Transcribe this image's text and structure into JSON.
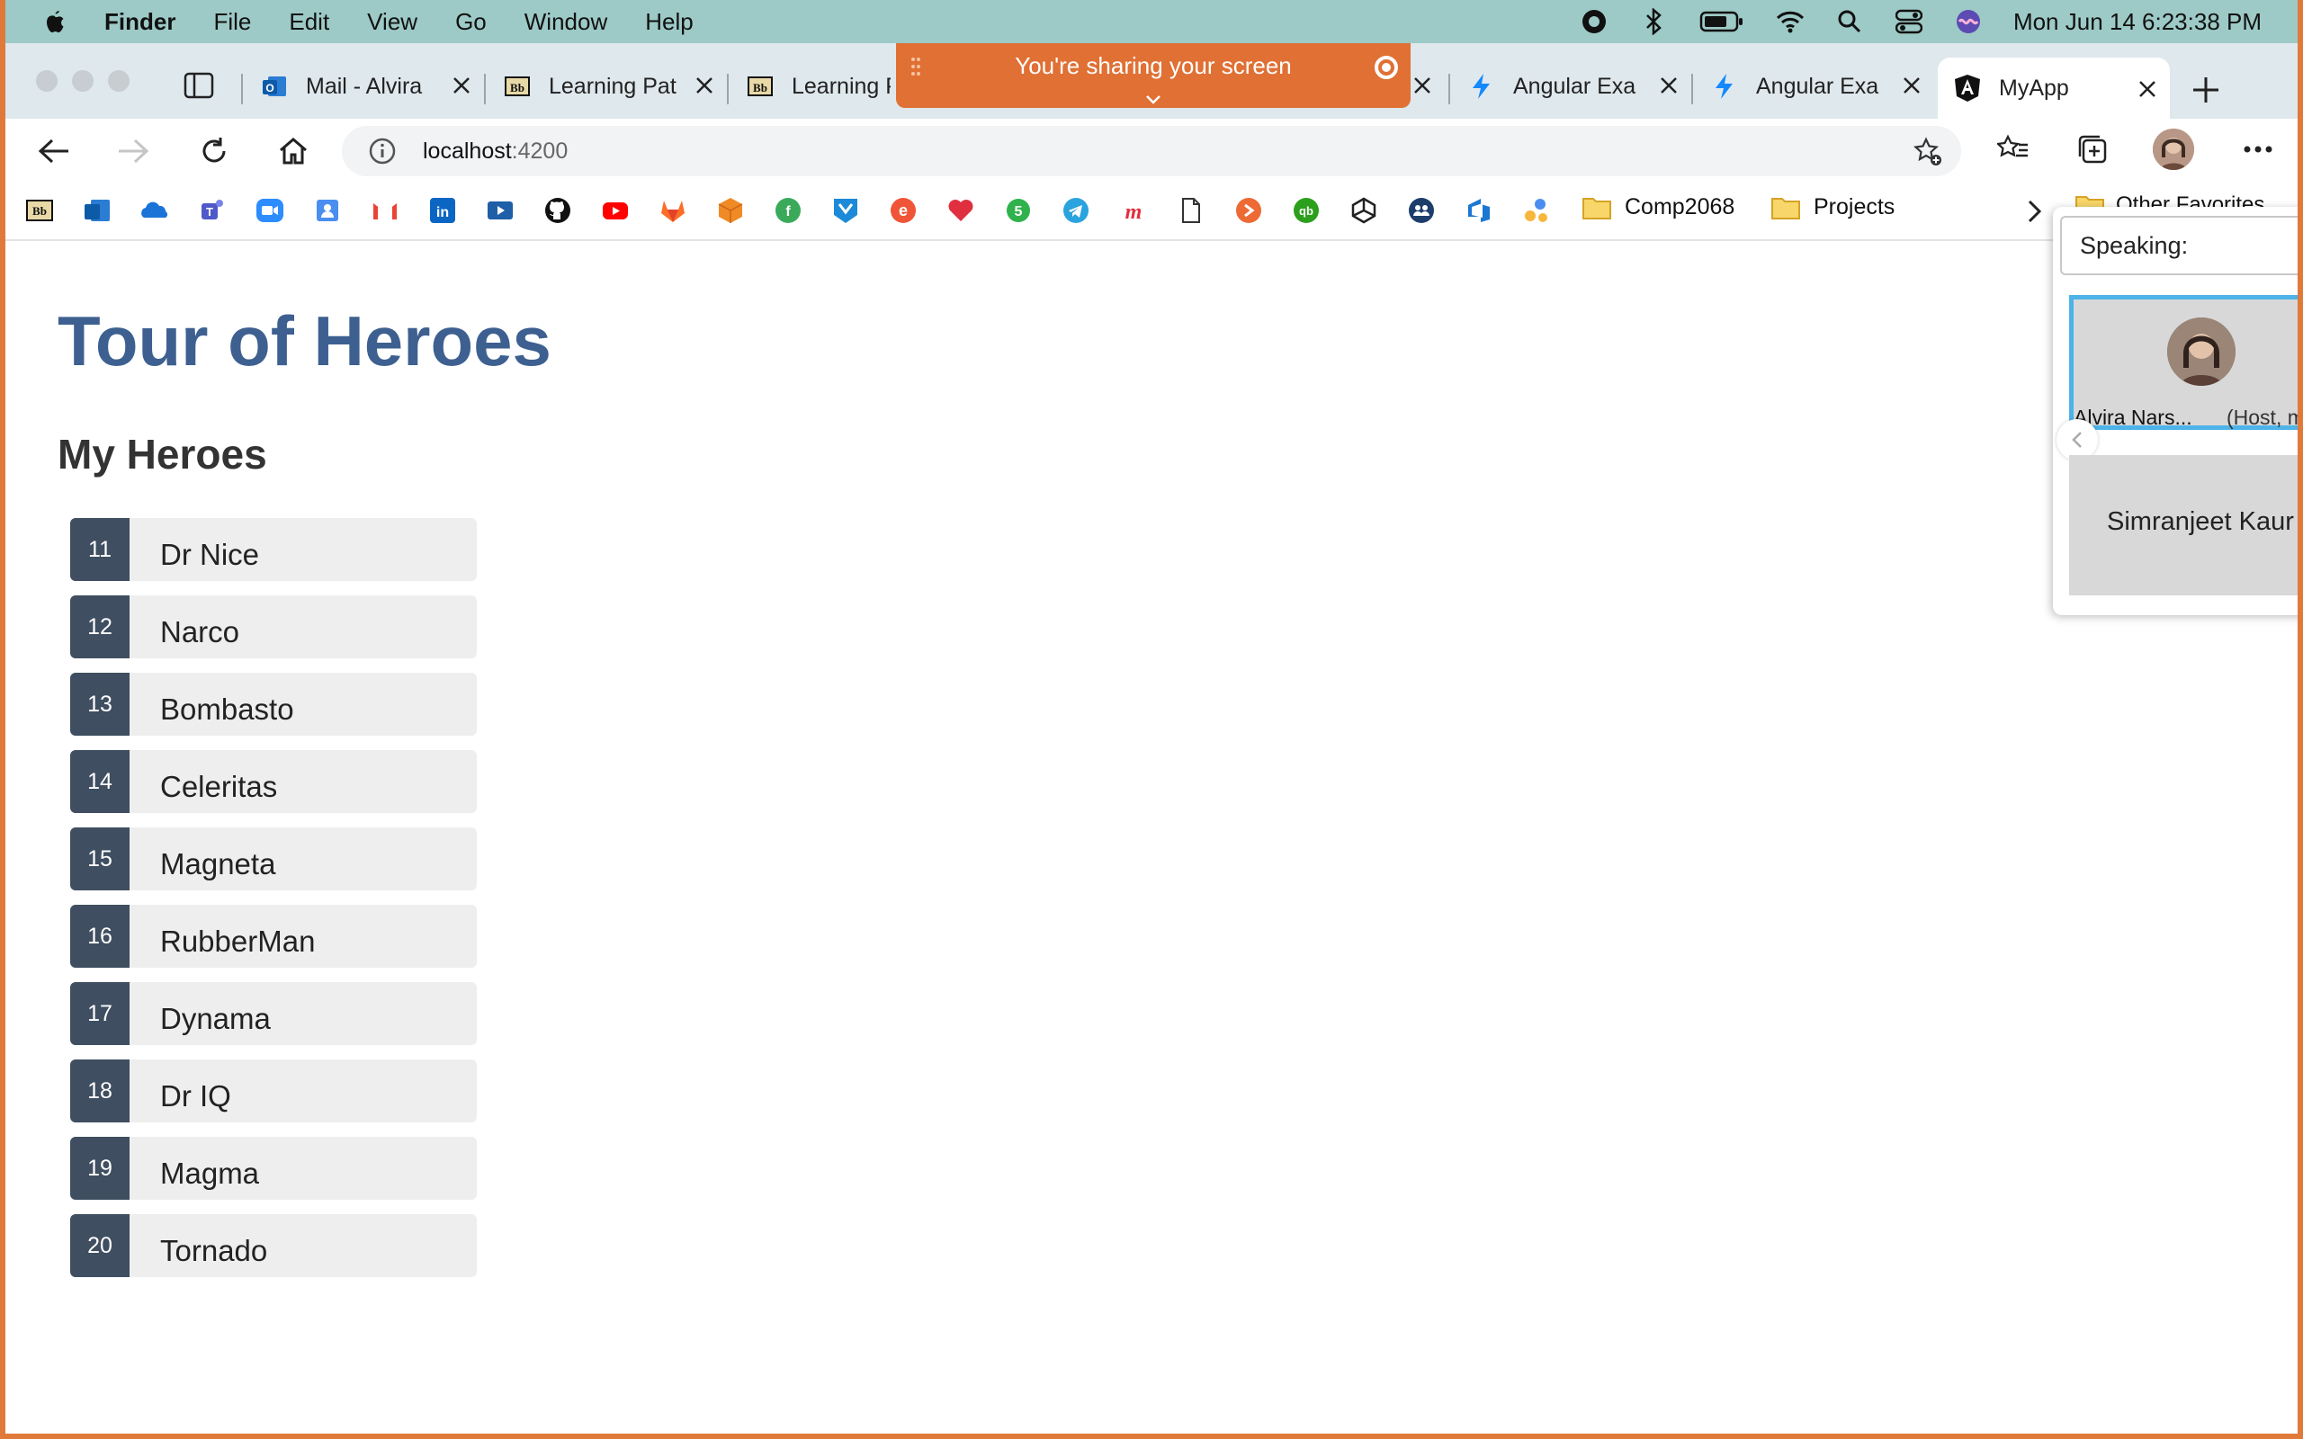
{
  "menubar": {
    "app": "Finder",
    "items": [
      "File",
      "Edit",
      "View",
      "Go",
      "Window",
      "Help"
    ],
    "clock": "Mon Jun 14  6:23:38 PM"
  },
  "share_banner": {
    "text": "You're sharing your screen"
  },
  "tabs": [
    {
      "label": "Mail - Alvira",
      "icon": "outlook-icon"
    },
    {
      "label": "Learning Pat",
      "icon": "blackboard-icon"
    },
    {
      "label": "Learning P",
      "icon": "blackboard-icon"
    },
    {
      "label": "Angular Exa",
      "icon": "stackblitz-icon"
    },
    {
      "label": "Angular Exa",
      "icon": "stackblitz-icon"
    },
    {
      "label": "MyApp",
      "icon": "angular-icon",
      "active": true
    }
  ],
  "address": {
    "host": "localhost",
    "port": ":4200"
  },
  "bookmarks": {
    "folders": [
      "Comp2068",
      "Projects"
    ],
    "other": "Other Favorites"
  },
  "page": {
    "title": "Tour of Heroes",
    "subtitle": "My Heroes",
    "heroes": [
      {
        "id": "11",
        "name": "Dr Nice"
      },
      {
        "id": "12",
        "name": "Narco"
      },
      {
        "id": "13",
        "name": "Bombasto"
      },
      {
        "id": "14",
        "name": "Celeritas"
      },
      {
        "id": "15",
        "name": "Magneta"
      },
      {
        "id": "16",
        "name": "RubberMan"
      },
      {
        "id": "17",
        "name": "Dynama"
      },
      {
        "id": "18",
        "name": "Dr IQ"
      },
      {
        "id": "19",
        "name": "Magma"
      },
      {
        "id": "20",
        "name": "Tornado"
      }
    ]
  },
  "teams": {
    "speaking_label": "Speaking:",
    "speaker_name": "Alvira Nars...",
    "speaker_role": "(Host, m",
    "other_participant": "Simranjeet Kaur"
  },
  "colors": {
    "title": "#3d6090",
    "badge": "#3f4e60",
    "hero_bg": "#eeeeee",
    "share_banner": "#e07034",
    "menubar": "#9dcac6"
  }
}
